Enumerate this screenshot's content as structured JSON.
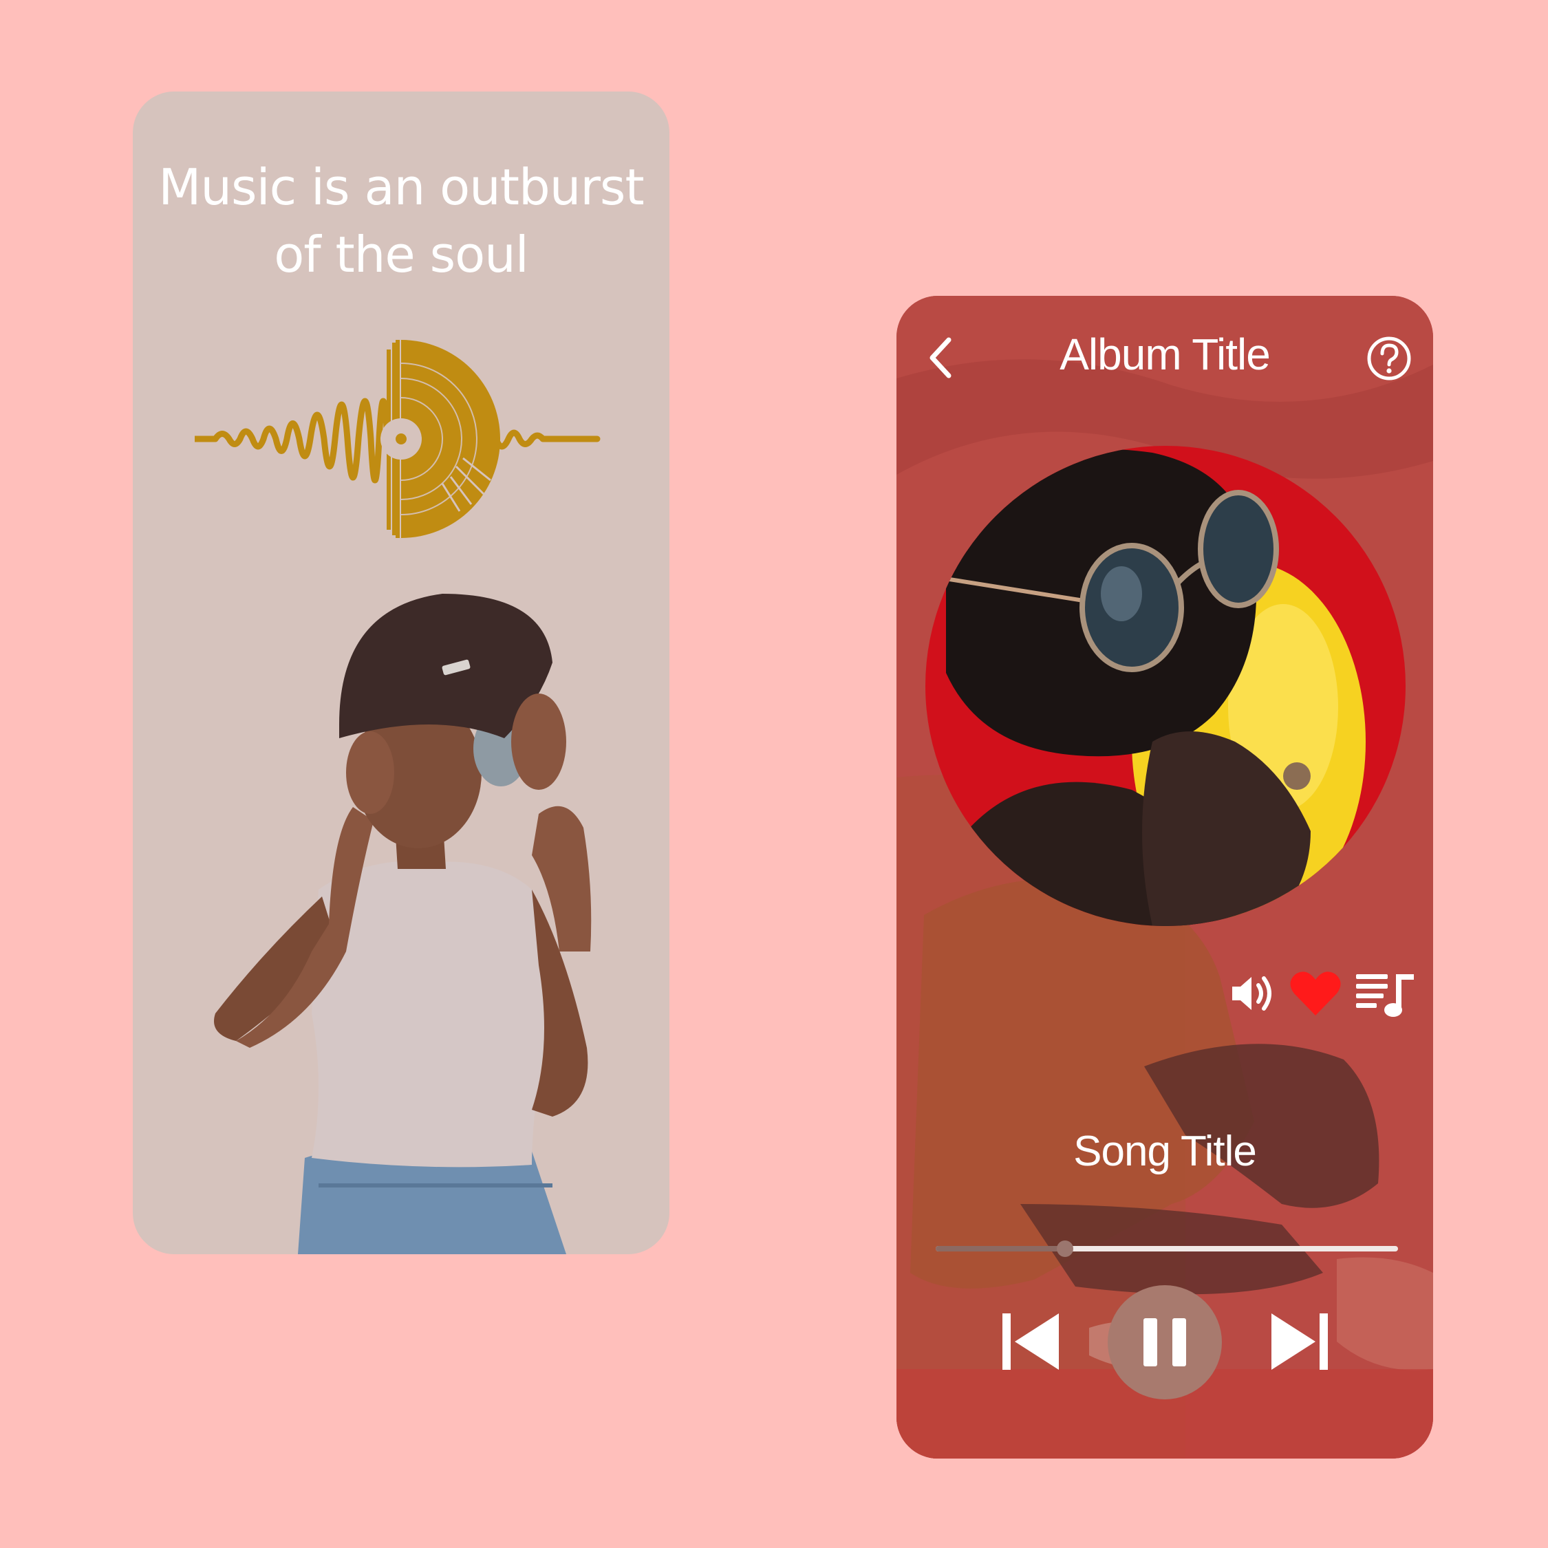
{
  "colors": {
    "page_background": "#ffbfbb",
    "left_card_background": "#d6c3bd",
    "logo_gold": "#c08c12",
    "right_card_background": "#b94a44",
    "heart_red": "#ff1a1a",
    "play_button": "#a87a6e"
  },
  "splash": {
    "quote_line1": "Music is an outburst",
    "quote_line2": "of the soul",
    "logo_icon": "sound-wave-vinyl-icon",
    "image": "woman-with-headphones-photo"
  },
  "player": {
    "album_title": "Album Title",
    "song_title": "Song Title",
    "back_icon": "chevron-left-icon",
    "help_icon": "question-circle-icon",
    "album_art": "man-in-sunglasses-photo",
    "background_image": "seated-person-photo",
    "actions": [
      {
        "icon": "volume-icon"
      },
      {
        "icon": "heart-icon",
        "active": true
      },
      {
        "icon": "playlist-icon"
      }
    ],
    "progress_fraction": 0.28,
    "controls": {
      "prev_icon": "skip-previous-icon",
      "play_state": "playing",
      "pause_icon": "pause-icon",
      "next_icon": "skip-next-icon"
    }
  }
}
